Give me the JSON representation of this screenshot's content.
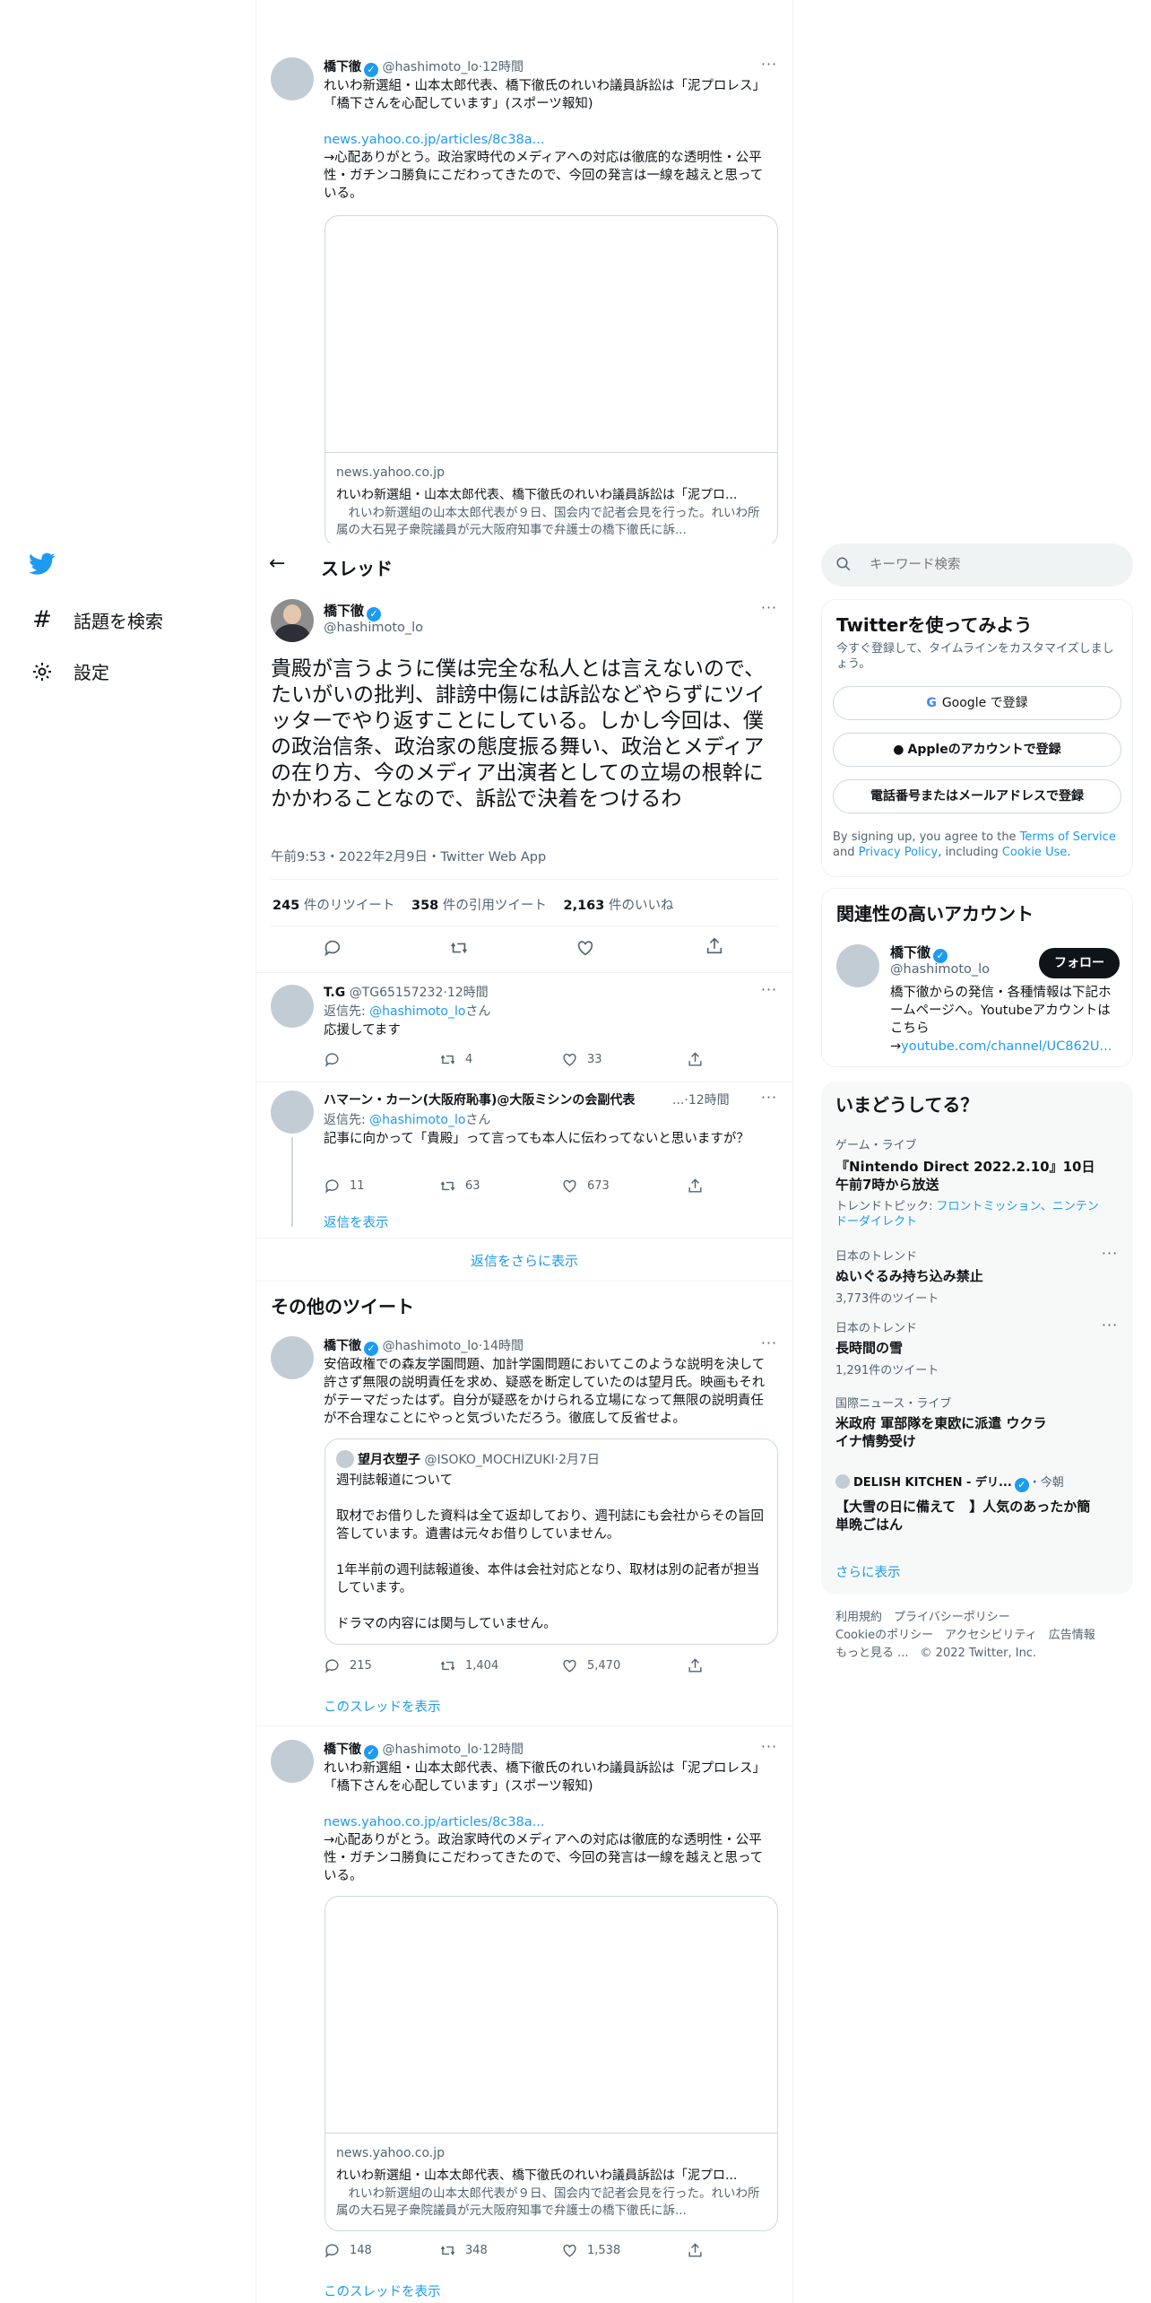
{
  "nav": {
    "explore_label": "話題を検索",
    "settings_label": "設定"
  },
  "header": {
    "title": "スレッド"
  },
  "search": {
    "placeholder": "キーワード検索"
  },
  "top_tweet": {
    "name": "橋下徹",
    "handle": "@hashimoto_lo",
    "time": "12時間",
    "text": "れいわ新選組・山本太郎代表、橋下徹氏のれいわ議員訴訟は「泥プロレス」「橋下さんを心配しています」(スポーツ報知)",
    "link": "news.yahoo.co.jp/articles/8c38a...",
    "text2": "→心配ありがとう。政治家時代のメディアへの対応は徹底的な透明性・公平性・ガチンコ勝負にこだわってきたので、今回の発言は一線を越えと思っている。",
    "card_domain": "news.yahoo.co.jp",
    "card_title": "れいわ新選組・山本太郎代表、橋下徹氏のれいわ議員訴訟は「泥プロ...",
    "card_desc": "　れいわ新選組の山本太郎代表が９日、国会内で記者会見を行った。れいわ所属の大石晃子衆院議員が元大阪府知事で弁護士の橋下徹氏に訴..."
  },
  "main_tweet": {
    "name": "橋下徹",
    "handle": "@hashimoto_lo",
    "text": "貴殿が言うように僕は完全な私人とは言えないので、たいがいの批判、誹謗中傷には訴訟などやらずにツイッターでやり返すことにしている。しかし今回は、僕の政治信条、政治家の態度振る舞い、政治とメディアの在り方、今のメディア出演者としての立場の根幹にかかわることなので、訴訟で決着をつけるわ",
    "meta": "午前9:53・2022年2月9日・Twitter Web App",
    "retweets": "245",
    "retweets_label": "件のリツイート",
    "quotes": "358",
    "quotes_label": "件の引用ツイート",
    "likes": "2,163",
    "likes_label": "件のいいね"
  },
  "replies": [
    {
      "name": "T.G",
      "handle": "@TG65157232",
      "time": "12時間",
      "reply_prefix": "返信先: ",
      "reply_to": "@hashimoto_lo",
      "reply_suffix": "さん",
      "text": "応援してます",
      "reply_count": "",
      "retweets": "4",
      "likes": "33"
    },
    {
      "name": "ハマーン・カーン(大阪府恥事)@大阪ミシンの会副代表",
      "handle": "...",
      "time": "12時間",
      "reply_prefix": "返信先: ",
      "reply_to": "@hashimoto_lo",
      "reply_suffix": "さん",
      "text": "記事に向かって「貴殿」って言っても本人に伝わってないと思いますが？",
      "reply_count": "11",
      "retweets": "63",
      "likes": "673",
      "show_replies": "返信を表示"
    }
  ],
  "more_replies": "返信をさらに表示",
  "other_tweets_heading": "その他のツイート",
  "other_tweet": {
    "name": "橋下徹",
    "handle": "@hashimoto_lo",
    "time": "14時間",
    "text": "安倍政権での森友学園問題、加計学園問題においてこのような説明を決して許さず無限の説明責任を求め、疑惑を断定していたのは望月氏。映画もそれがテーマだったはず。自分が疑惑をかけられる立場になって無限の説明責任が不合理なことにやっと気づいただろう。徹底して反省せよ。",
    "quote_name": "望月衣塑子",
    "quote_handle": "@ISOKO_MOCHIZUKI",
    "quote_time": "2月7日",
    "quote_text": "週刊誌報道について\n\n取材でお借りした資料は全て返却しており、週刊誌にも会社からその旨回答しています。遺書は元々お借りしていません。\n\n1年半前の週刊誌報道後、本件は会社対応となり、取材は別の記者が担当しています。\n\nドラマの内容には関与していません。",
    "reply_count": "215",
    "retweets": "1,404",
    "likes": "5,470",
    "show_thread": "このスレッドを表示"
  },
  "bottom_tweet": {
    "name": "橋下徹",
    "handle": "@hashimoto_lo",
    "time": "12時間",
    "text": "れいわ新選組・山本太郎代表、橋下徹氏のれいわ議員訴訟は「泥プロレス」「橋下さんを心配しています」(スポーツ報知)",
    "link": "news.yahoo.co.jp/articles/8c38a...",
    "text2": "→心配ありがとう。政治家時代のメディアへの対応は徹底的な透明性・公平性・ガチンコ勝負にこだわってきたので、今回の発言は一線を越えと思っている。",
    "card_domain": "news.yahoo.co.jp",
    "card_title": "れいわ新選組・山本太郎代表、橋下徹氏のれいわ議員訴訟は「泥プロ...",
    "card_desc": "　れいわ新選組の山本太郎代表が９日、国会内で記者会見を行った。れいわ所属の大石晃子衆院議員が元大阪府知事で弁護士の橋下徹氏に訴...",
    "reply_count": "148",
    "retweets": "348",
    "likes": "1,538",
    "show_thread": "このスレッドを表示"
  },
  "signup": {
    "title": "Twitterを使ってみよう",
    "subtitle": "今すぐ登録して、タイムラインをカスタマイズしましょう。",
    "google": "Google で登録",
    "apple": "Appleのアカウントで登録",
    "phone": "電話番号またはメールアドレスで登録",
    "terms_prefix": "By signing up, you agree to the ",
    "terms": "Terms of Service",
    "and": " and ",
    "privacy": "Privacy Policy",
    "including": ", including ",
    "cookie": "Cookie Use",
    "period": "."
  },
  "related": {
    "title": "関連性の高いアカウント",
    "name": "橋下徹",
    "handle": "@hashimoto_lo",
    "follow": "フォロー",
    "bio": "橋下徹からの発信・各種情報は下記ホームページへ。Youtubeアカウントはこちら",
    "bio_arrow": "→",
    "bio_link": "youtube.com/channel/UC862U..."
  },
  "trends": {
    "title": "いまどうしてる？",
    "items": [
      {
        "category": "ゲーム・ライブ",
        "title": "『Nintendo Direct 2022.2.10』10日午前7時から放送",
        "topic_prefix": "トレンドトピック: ",
        "topic": "フロントミッション、ニンテンドーダイレクト"
      },
      {
        "category": "日本のトレンド",
        "title": "ぬいぐるみ持ち込み禁止",
        "count": "3,773件のツイート"
      },
      {
        "category": "日本のトレンド",
        "title": "長時間の雪",
        "count": "1,291件のツイート"
      },
      {
        "category": "国際ニュース・ライブ",
        "title": "米政府 軍部隊を東欧に派遣 ウクライナ情勢受け"
      },
      {
        "category": "DELISH KITCHEN - デリ...",
        "time": "・今朝",
        "title": "【大雪の日に備えて　】人気のあったか簡単晩ごはん"
      }
    ],
    "more": "さらに表示"
  },
  "footer": {
    "terms": "利用規約",
    "privacy": "プライバシーポリシー",
    "cookie": "Cookieのポリシー",
    "accessibility": "アクセシビリティ",
    "ads": "広告情報",
    "more": "もっと見る ...",
    "copyright": "© 2022 Twitter, Inc."
  },
  "colors": {
    "accent": "#1d9bf0",
    "text": "#0f1419",
    "muted": "#536471",
    "border": "#eff3f4"
  }
}
